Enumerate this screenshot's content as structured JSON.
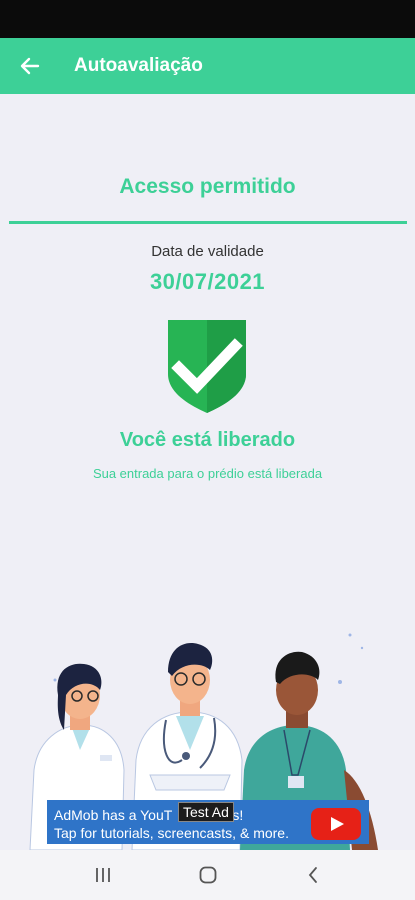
{
  "header": {
    "title": "Autoavaliação",
    "back_icon": "arrow-left-icon"
  },
  "status": {
    "title": "Acesso permitido",
    "validity_label": "Data de validade",
    "validity_date": "30/07/2021",
    "icon": "shield-check-icon",
    "message": "Você está liberado",
    "submessage": "Sua entrada para o prédio está liberada"
  },
  "ad": {
    "line1": "AdMob has a YouT",
    "line1_tail": "s!",
    "line2": "Tap for tutorials, screencasts, & more.",
    "tag": "Test Ad"
  },
  "colors": {
    "accent": "#3dd097",
    "shield": "#27b454",
    "ad_bg": "#2f74c8",
    "background": "#efeff6"
  }
}
